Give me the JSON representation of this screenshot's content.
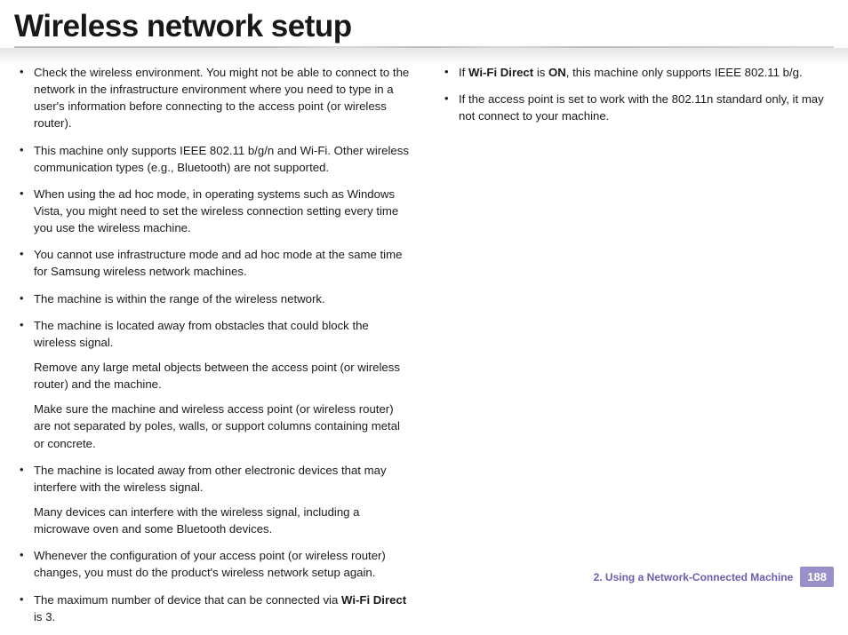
{
  "title": "Wireless network setup",
  "left_column": [
    {
      "text": "Check the wireless environment. You might not be able to connect to the network in the infrastructure environment where you need to type in a user's information before connecting to the access point (or wireless router)."
    },
    {
      "text": "This machine only supports IEEE 802.11 b/g/n and Wi-Fi. Other wireless communication types (e.g., Bluetooth) are not supported."
    },
    {
      "text": "When using the ad hoc mode, in operating systems such as Windows Vista, you might need to set the wireless connection setting every time you use the wireless machine."
    },
    {
      "text": "You cannot use infrastructure mode and ad hoc mode at the same time for Samsung wireless network machines."
    },
    {
      "text": "The machine is within the range of the wireless network."
    },
    {
      "text": "The machine is located away from obstacles that could block the wireless signal.",
      "subs": [
        "Remove any large metal objects between the access point (or wireless router) and the machine.",
        "Make sure the machine and wireless access point (or wireless router) are not separated by poles, walls, or support columns containing metal or concrete."
      ]
    },
    {
      "text": "The machine is located away from other electronic devices that may interfere with the wireless signal.",
      "subs": [
        "Many devices can interfere with the wireless signal, including a microwave oven and some Bluetooth devices."
      ]
    },
    {
      "text": "Whenever the configuration of your access point (or wireless router) changes, you must do the product's wireless network setup again."
    },
    {
      "html": "The maximum number of device that can be connected via <span class=\"bold\">Wi-Fi Direct</span> is 3."
    }
  ],
  "right_column": [
    {
      "html": "If <span class=\"bold\">Wi-Fi Direct</span> is <span class=\"bold\">ON</span>, this machine only supports IEEE 802.11 b/g."
    },
    {
      "text": "If the access point is set to work with the 802.11n standard only, it may not connect to your machine."
    }
  ],
  "footer": {
    "section": "2.  Using a Network-Connected Machine",
    "page": "188"
  }
}
